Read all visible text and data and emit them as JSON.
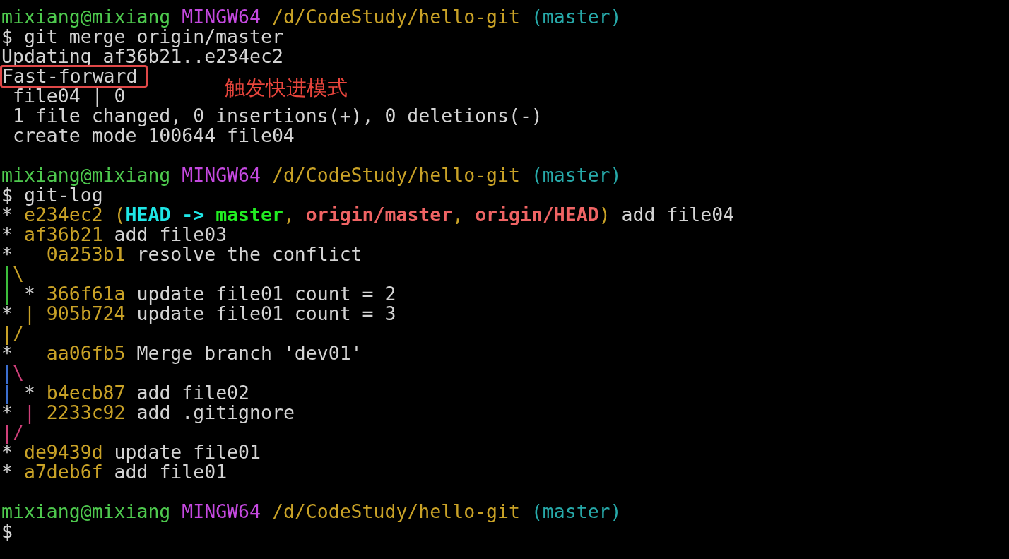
{
  "terminal": {
    "lines": [
      {
        "kind": "text",
        "segments": [
          {
            "text": "mixiang@mixiang ",
            "color": "#4ec94e",
            "bold": false
          },
          {
            "text": "MINGW64 ",
            "color": "#c549e0",
            "bold": false
          },
          {
            "text": "/d/CodeStudy/hello-git ",
            "color": "#c9a227",
            "bold": false
          },
          {
            "text": "(master)",
            "color": "#27a9a9",
            "bold": false
          }
        ]
      },
      {
        "kind": "text",
        "segments": [
          {
            "text": "$ git merge origin/master",
            "color": "#d4d4d4",
            "bold": false
          }
        ]
      },
      {
        "kind": "text",
        "segments": [
          {
            "text": "Updating af36b21..e234ec2",
            "color": "#d4d4d4",
            "bold": false
          }
        ]
      },
      {
        "kind": "boxed",
        "segments": [
          {
            "text": "Fast-forward",
            "color": "#d4d4d4",
            "bold": false
          }
        ]
      },
      {
        "kind": "text",
        "segments": [
          {
            "text": " file04 | 0",
            "color": "#d4d4d4",
            "bold": false
          }
        ]
      },
      {
        "kind": "text",
        "segments": [
          {
            "text": " 1 file changed, 0 insertions(+), 0 deletions(-)",
            "color": "#d4d4d4",
            "bold": false
          }
        ]
      },
      {
        "kind": "text",
        "segments": [
          {
            "text": " create mode 100644 file04",
            "color": "#d4d4d4",
            "bold": false
          }
        ]
      },
      {
        "kind": "blank"
      },
      {
        "kind": "text",
        "segments": [
          {
            "text": "mixiang@mixiang ",
            "color": "#4ec94e",
            "bold": false
          },
          {
            "text": "MINGW64 ",
            "color": "#c549e0",
            "bold": false
          },
          {
            "text": "/d/CodeStudy/hello-git ",
            "color": "#c9a227",
            "bold": false
          },
          {
            "text": "(master)",
            "color": "#27a9a9",
            "bold": false
          }
        ]
      },
      {
        "kind": "text",
        "segments": [
          {
            "text": "$ git-log",
            "color": "#d4d4d4",
            "bold": false
          }
        ]
      },
      {
        "kind": "text",
        "segments": [
          {
            "text": "* ",
            "color": "#d4d4d4",
            "bold": false
          },
          {
            "text": "e234ec2 (",
            "color": "#c9a227",
            "bold": false
          },
          {
            "text": "HEAD -> ",
            "color": "#1ee6e6",
            "bold": true
          },
          {
            "text": "master",
            "color": "#22ee22",
            "bold": true
          },
          {
            "text": ", ",
            "color": "#c9a227",
            "bold": false
          },
          {
            "text": "origin/master",
            "color": "#ef6464",
            "bold": true
          },
          {
            "text": ", ",
            "color": "#c9a227",
            "bold": false
          },
          {
            "text": "origin/HEAD",
            "color": "#ef6464",
            "bold": true
          },
          {
            "text": ")",
            "color": "#c9a227",
            "bold": false
          },
          {
            "text": " add file04",
            "color": "#d4d4d4",
            "bold": false
          }
        ]
      },
      {
        "kind": "text",
        "segments": [
          {
            "text": "* ",
            "color": "#d4d4d4",
            "bold": false
          },
          {
            "text": "af36b21",
            "color": "#c9a227",
            "bold": false
          },
          {
            "text": " add file03",
            "color": "#d4d4d4",
            "bold": false
          }
        ]
      },
      {
        "kind": "text",
        "segments": [
          {
            "text": "*   ",
            "color": "#d4d4d4",
            "bold": false
          },
          {
            "text": "0a253b1",
            "color": "#c9a227",
            "bold": false
          },
          {
            "text": " resolve the conflict",
            "color": "#d4d4d4",
            "bold": false
          }
        ]
      },
      {
        "kind": "text",
        "segments": [
          {
            "text": "|",
            "color": "#3cbf3c",
            "bold": false
          },
          {
            "text": "\\",
            "color": "#c9a227",
            "bold": false
          }
        ]
      },
      {
        "kind": "text",
        "segments": [
          {
            "text": "| ",
            "color": "#3cbf3c",
            "bold": false
          },
          {
            "text": "* ",
            "color": "#d4d4d4",
            "bold": false
          },
          {
            "text": "366f61a",
            "color": "#c9a227",
            "bold": false
          },
          {
            "text": " update file01 count = 2",
            "color": "#d4d4d4",
            "bold": false
          }
        ]
      },
      {
        "kind": "text",
        "segments": [
          {
            "text": "* ",
            "color": "#d4d4d4",
            "bold": false
          },
          {
            "text": "| ",
            "color": "#c9a227",
            "bold": false
          },
          {
            "text": "905b724",
            "color": "#c9a227",
            "bold": false
          },
          {
            "text": " update file01 count = 3",
            "color": "#d4d4d4",
            "bold": false
          }
        ]
      },
      {
        "kind": "text",
        "segments": [
          {
            "text": "|/",
            "color": "#c9a227",
            "bold": false
          }
        ]
      },
      {
        "kind": "text",
        "segments": [
          {
            "text": "*   ",
            "color": "#d4d4d4",
            "bold": false
          },
          {
            "text": "aa06fb5",
            "color": "#c9a227",
            "bold": false
          },
          {
            "text": " Merge branch 'dev01'",
            "color": "#d4d4d4",
            "bold": false
          }
        ]
      },
      {
        "kind": "text",
        "segments": [
          {
            "text": "|",
            "color": "#3c6fd0",
            "bold": false
          },
          {
            "text": "\\",
            "color": "#d0407a",
            "bold": false
          }
        ]
      },
      {
        "kind": "text",
        "segments": [
          {
            "text": "| ",
            "color": "#3c6fd0",
            "bold": false
          },
          {
            "text": "* ",
            "color": "#d4d4d4",
            "bold": false
          },
          {
            "text": "b4ecb87",
            "color": "#c9a227",
            "bold": false
          },
          {
            "text": " add file02",
            "color": "#d4d4d4",
            "bold": false
          }
        ]
      },
      {
        "kind": "text",
        "segments": [
          {
            "text": "* ",
            "color": "#d4d4d4",
            "bold": false
          },
          {
            "text": "| ",
            "color": "#d0407a",
            "bold": false
          },
          {
            "text": "2233c92",
            "color": "#c9a227",
            "bold": false
          },
          {
            "text": " add .gitignore",
            "color": "#d4d4d4",
            "bold": false
          }
        ]
      },
      {
        "kind": "text",
        "segments": [
          {
            "text": "|/",
            "color": "#d0407a",
            "bold": false
          }
        ]
      },
      {
        "kind": "text",
        "segments": [
          {
            "text": "* ",
            "color": "#d4d4d4",
            "bold": false
          },
          {
            "text": "de9439d",
            "color": "#c9a227",
            "bold": false
          },
          {
            "text": " update file01",
            "color": "#d4d4d4",
            "bold": false
          }
        ]
      },
      {
        "kind": "text",
        "segments": [
          {
            "text": "* ",
            "color": "#d4d4d4",
            "bold": false
          },
          {
            "text": "a7deb6f",
            "color": "#c9a227",
            "bold": false
          },
          {
            "text": " add file01",
            "color": "#d4d4d4",
            "bold": false
          }
        ]
      },
      {
        "kind": "blank"
      },
      {
        "kind": "text",
        "segments": [
          {
            "text": "mixiang@mixiang ",
            "color": "#4ec94e",
            "bold": false
          },
          {
            "text": "MINGW64 ",
            "color": "#c549e0",
            "bold": false
          },
          {
            "text": "/d/CodeStudy/hello-git ",
            "color": "#c9a227",
            "bold": false
          },
          {
            "text": "(master)",
            "color": "#27a9a9",
            "bold": false
          }
        ]
      },
      {
        "kind": "text",
        "segments": [
          {
            "text": "$",
            "color": "#d4d4d4",
            "bold": false
          }
        ]
      }
    ]
  },
  "annotation": {
    "text": "触发快进模式"
  }
}
